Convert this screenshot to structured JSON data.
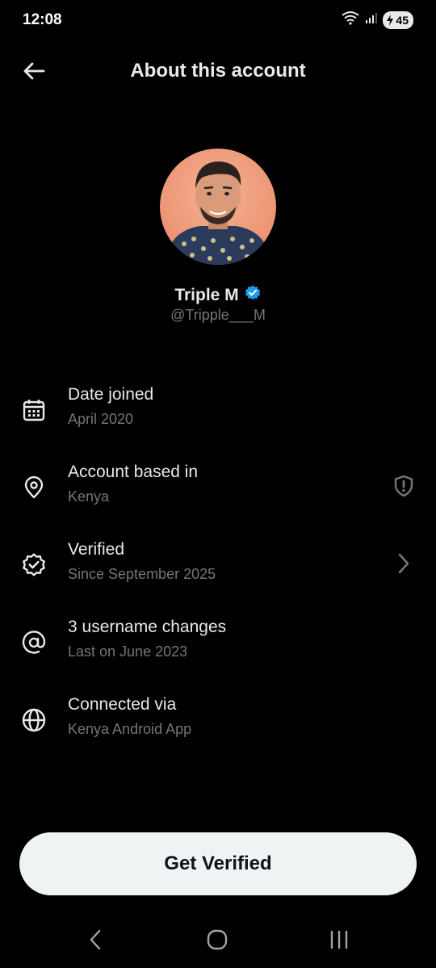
{
  "status_bar": {
    "time": "12:08",
    "battery": "45"
  },
  "header": {
    "title": "About this account"
  },
  "profile": {
    "name": "Triple M",
    "handle": "@Tripple___M"
  },
  "info_items": [
    {
      "icon": "calendar-icon",
      "title": "Date joined",
      "subtitle": "April 2020"
    },
    {
      "icon": "location-pin-icon",
      "title": "Account based in",
      "subtitle": "Kenya",
      "trailing": "shield-alert-icon"
    },
    {
      "icon": "verified-badge-icon",
      "title": "Verified",
      "subtitle": "Since September 2025",
      "trailing": "chevron-right-icon"
    },
    {
      "icon": "at-sign-icon",
      "title": "3 username changes",
      "subtitle": "Last on June 2023"
    },
    {
      "icon": "globe-icon",
      "title": "Connected via",
      "subtitle": "Kenya Android App"
    }
  ],
  "cta": {
    "label": "Get Verified"
  },
  "colors": {
    "background": "#000000",
    "text_primary": "#e7e9ea",
    "text_secondary": "#71767b",
    "verified_blue": "#1d9bf0",
    "button_bg": "#eff3f4"
  }
}
